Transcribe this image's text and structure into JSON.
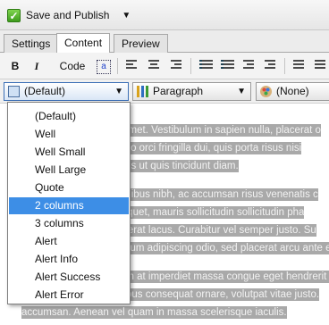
{
  "toolbar": {
    "publish_label": "Save and Publish",
    "publish_dropdown": "▼"
  },
  "tabs": [
    {
      "label": "Settings"
    },
    {
      "label": "Content",
      "active": true
    },
    {
      "label": "Preview"
    }
  ],
  "format_toolbar": {
    "bold": "B",
    "italic": "I",
    "code": "Code",
    "insert_text": "a"
  },
  "selects": {
    "style": {
      "value": "(Default)",
      "icon": "document-icon"
    },
    "format": {
      "value": "Paragraph",
      "icon": "bars-icon"
    },
    "class": {
      "value": "(None)",
      "icon": "palette-icon"
    },
    "arrow": "▼"
  },
  "style_menu": {
    "items": [
      "(Default)",
      "Well",
      "Well Small",
      "Well Large",
      "Quote",
      "2 columns",
      "3 columns",
      "Alert",
      "Alert Info",
      "Alert Success",
      "Alert Error"
    ],
    "selected": "2 columns"
  },
  "content": {
    "paragraphs": [
      [
        "Lorem ipsum dolor sit amet. Vestibulum in sapien nulla, placerat o",
        "tortor at risus. Nunc a leo orci fringilla dui, quis porta risus nisi",
        "eleifend mauris. Vivamus ut quis tincidunt diam."
      ],
      [
        "Quisque ut nibh. Sed finibus nibh, ac accumsan risus venenatis c",
        "Proin nec magna et. Aliquet, mauris sollicitudin sollicitudin pha",
        "id est quis lacus a, placerat lacus. Curabitur vel semper justo. Su",
        "sapien at nunc. Vestibulum adipiscing odio, sed placerat arcu ante eu lig"
      ],
      [
        "Donec imperdiet. Nullam at imperdiet massa congue eget hendrerit tellus v",
        "placerat. Curabitur tempus consequat ornare, volutpat vitae justo.",
        "accumsan. Aenean vel quam in massa scelerisque iaculis."
      ]
    ]
  },
  "colors": {
    "selection_highlight": "#3d8ee6",
    "text_selection_bg": "#a9a9a9"
  }
}
